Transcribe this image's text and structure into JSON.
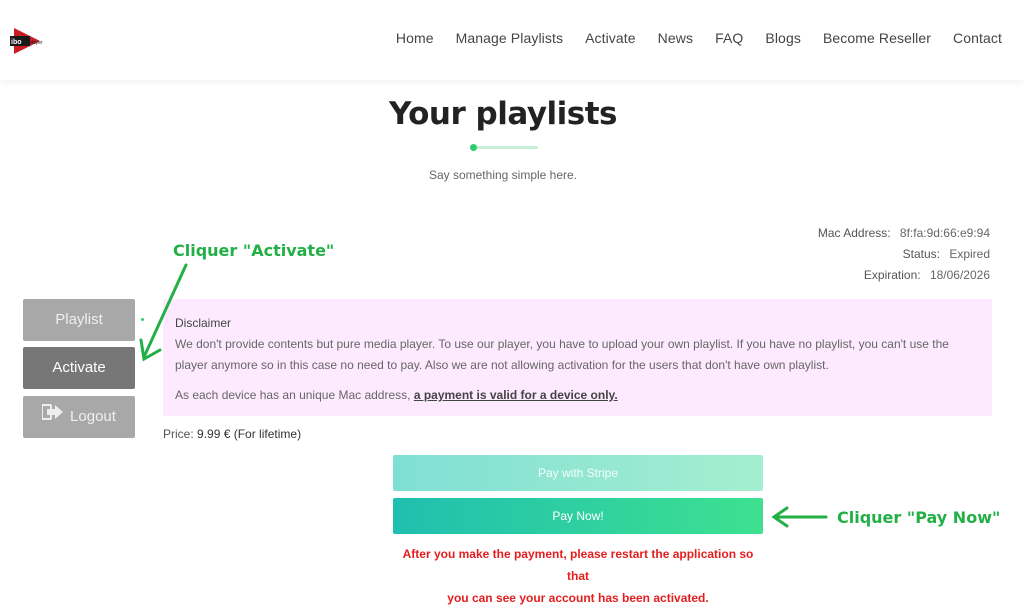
{
  "header": {
    "logo_text": "ibo player",
    "nav": [
      "Home",
      "Manage Playlists",
      "Activate",
      "News",
      "FAQ",
      "Blogs",
      "Become Reseller",
      "Contact"
    ]
  },
  "main": {
    "title": "Your playlists",
    "subtitle": "Say something simple here."
  },
  "device": {
    "mac_label": "Mac Address:",
    "mac_value": "8f:fa:9d:66:e9:94",
    "status_label": "Status:",
    "status_value": "Expired",
    "expiration_label": "Expiration:",
    "expiration_value": "18/06/2026"
  },
  "sidebar": {
    "playlist": "Playlist",
    "activate": "Activate",
    "logout": "Logout"
  },
  "disclaimer": {
    "title": "Disclaimer",
    "body": "We don't provide contents but pure media player. To use our player, you have to upload your own playlist. If you have no playlist, you can't use the player anymore so in this case no need to pay. Also we are not allowing activation for the users that don't have own playlist.",
    "line2_prefix": "As each device has an unique Mac address, ",
    "line2_link": "a payment is valid for a device only."
  },
  "price": {
    "label": "Price:",
    "value": "9.99 € (For lifetime)"
  },
  "payment": {
    "stripe_label": "Pay with Stripe",
    "paynow_label": "Pay Now!",
    "warning_line1": "After you make the payment, please restart the application so that",
    "warning_line2": "you can see your account has been activated."
  },
  "annotations": {
    "activate": "Cliquer \"Activate\"",
    "paynow": "Cliquer \"Pay Now\"",
    "color": "#22b046"
  },
  "colors": {
    "accent_green": "#2ecc71",
    "warning_red": "#e41e1e",
    "disclaimer_bg": "#fdeaff"
  }
}
